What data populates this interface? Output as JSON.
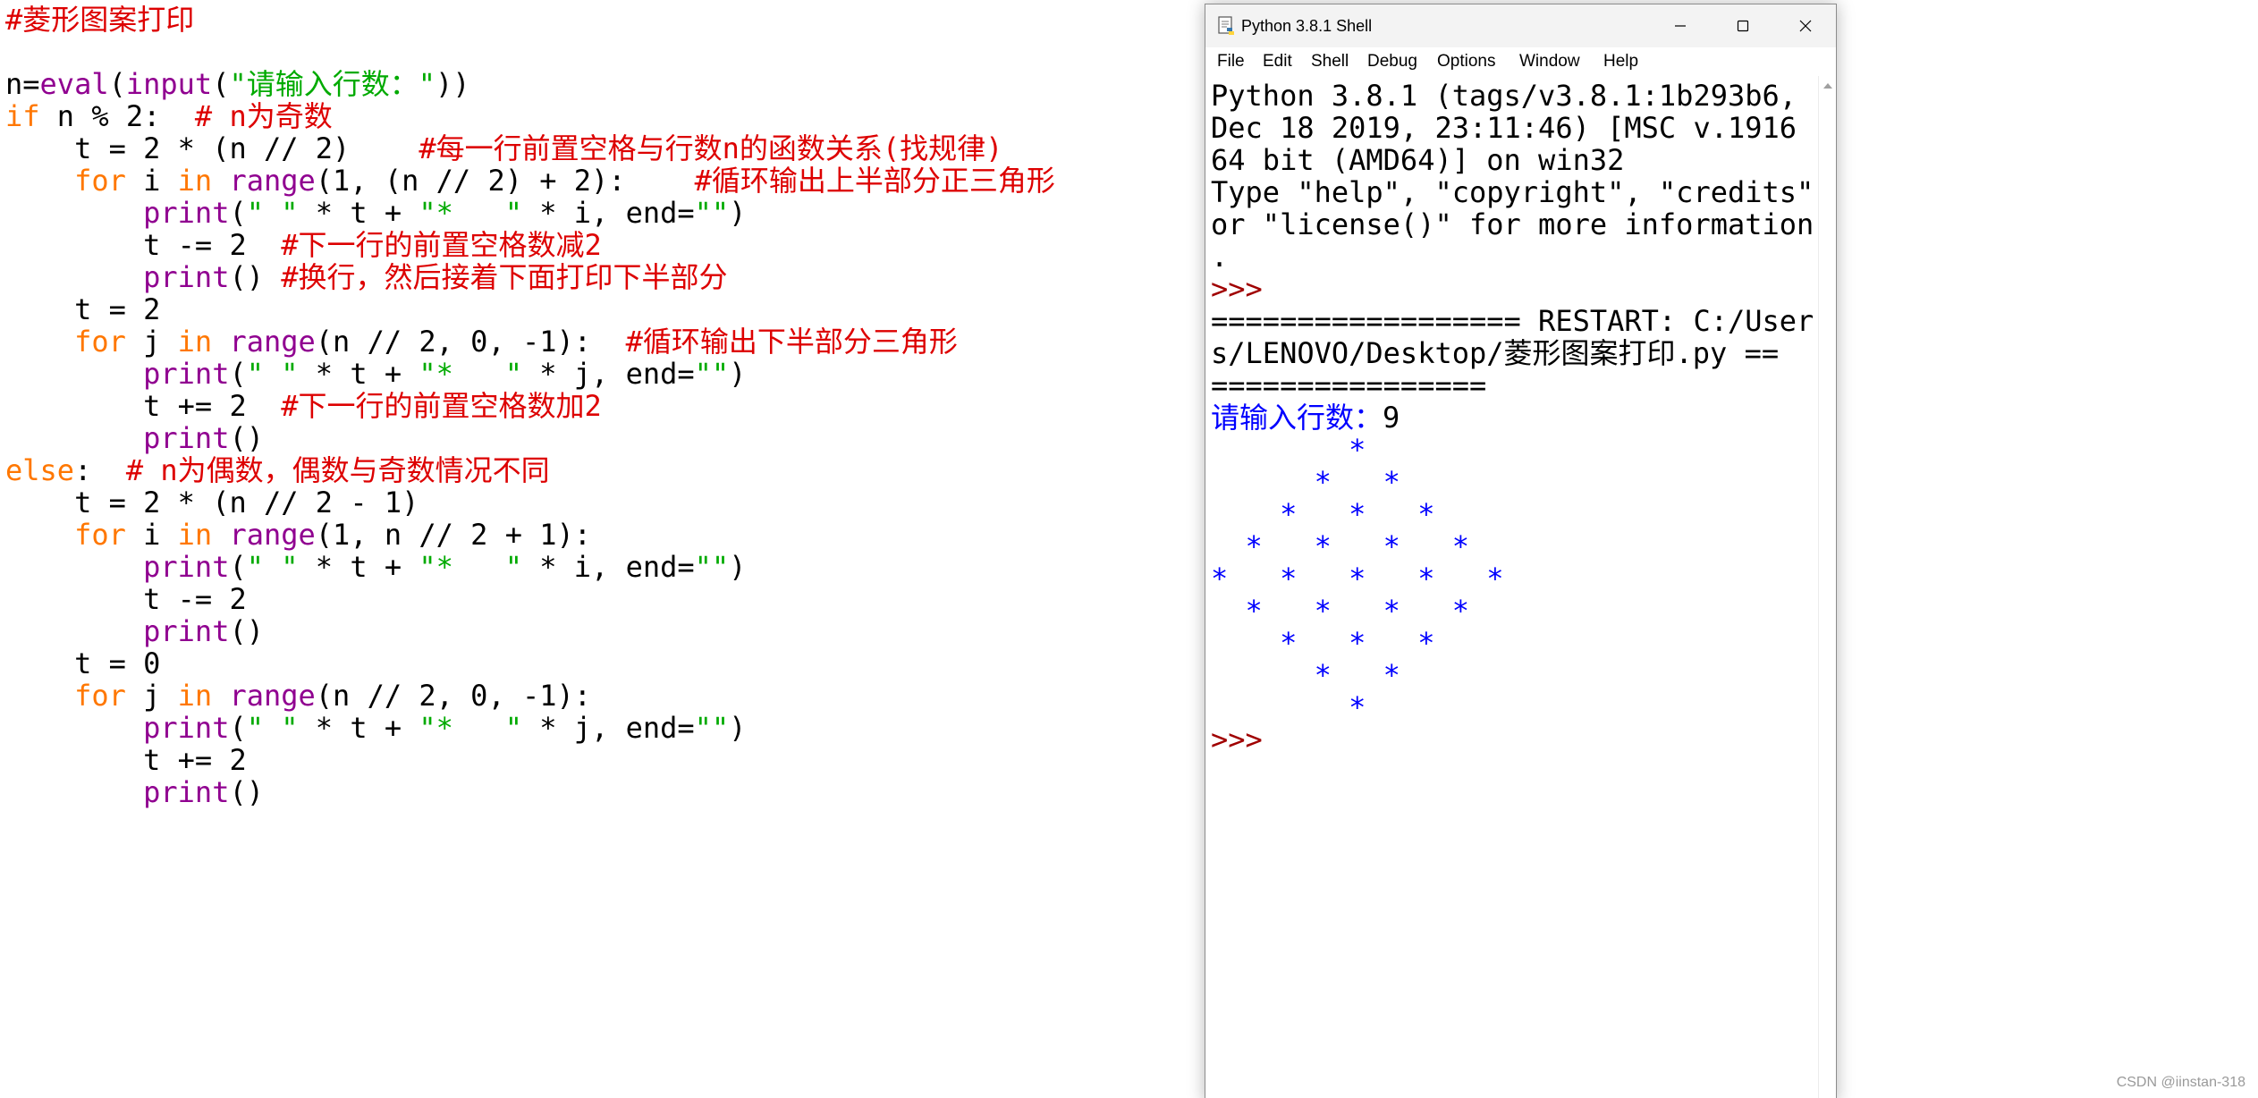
{
  "editor": {
    "lines": [
      [
        [
          "c",
          "#菱形图案打印"
        ]
      ],
      [],
      [
        [
          "d",
          "n="
        ],
        [
          "b",
          "eval"
        ],
        [
          "d",
          "("
        ],
        [
          "b",
          "input"
        ],
        [
          "d",
          "("
        ],
        [
          "s",
          "\"请输入行数：\""
        ],
        [
          "d",
          "))"
        ]
      ],
      [
        [
          "k",
          "if"
        ],
        [
          "d",
          " n % 2:  "
        ],
        [
          "c",
          "# n为奇数"
        ]
      ],
      [
        [
          "d",
          "    t = 2 * (n // 2)    "
        ],
        [
          "c",
          "#每一行前置空格与行数n的函数关系(找规律)"
        ]
      ],
      [
        [
          "d",
          "    "
        ],
        [
          "k",
          "for"
        ],
        [
          "d",
          " i "
        ],
        [
          "k",
          "in"
        ],
        [
          "d",
          " "
        ],
        [
          "b",
          "range"
        ],
        [
          "d",
          "(1, (n // 2) + 2):    "
        ],
        [
          "c",
          "#循环输出上半部分正三角形"
        ]
      ],
      [
        [
          "d",
          "        "
        ],
        [
          "b",
          "print"
        ],
        [
          "d",
          "("
        ],
        [
          "s",
          "\" \""
        ],
        [
          "d",
          " * t + "
        ],
        [
          "s",
          "\"*   \""
        ],
        [
          "d",
          " * i, end="
        ],
        [
          "s",
          "\"\""
        ],
        [
          "d",
          ")"
        ]
      ],
      [
        [
          "d",
          "        t -= 2  "
        ],
        [
          "c",
          "#下一行的前置空格数减2"
        ]
      ],
      [
        [
          "d",
          "        "
        ],
        [
          "b",
          "print"
        ],
        [
          "d",
          "() "
        ],
        [
          "c",
          "#换行，然后接着下面打印下半部分"
        ]
      ],
      [
        [
          "d",
          "    t = 2"
        ]
      ],
      [
        [
          "d",
          "    "
        ],
        [
          "k",
          "for"
        ],
        [
          "d",
          " j "
        ],
        [
          "k",
          "in"
        ],
        [
          "d",
          " "
        ],
        [
          "b",
          "range"
        ],
        [
          "d",
          "(n // 2, 0, -1):  "
        ],
        [
          "c",
          "#循环输出下半部分三角形"
        ]
      ],
      [
        [
          "d",
          "        "
        ],
        [
          "b",
          "print"
        ],
        [
          "d",
          "("
        ],
        [
          "s",
          "\" \""
        ],
        [
          "d",
          " * t + "
        ],
        [
          "s",
          "\"*   \""
        ],
        [
          "d",
          " * j, end="
        ],
        [
          "s",
          "\"\""
        ],
        [
          "d",
          ")"
        ]
      ],
      [
        [
          "d",
          "        t += 2  "
        ],
        [
          "c",
          "#下一行的前置空格数加2"
        ]
      ],
      [
        [
          "d",
          "        "
        ],
        [
          "b",
          "print"
        ],
        [
          "d",
          "()"
        ]
      ],
      [
        [
          "k",
          "else"
        ],
        [
          "d",
          ":  "
        ],
        [
          "c",
          "# n为偶数，偶数与奇数情况不同"
        ]
      ],
      [
        [
          "d",
          "    t = 2 * (n // 2 - 1)"
        ]
      ],
      [
        [
          "d",
          "    "
        ],
        [
          "k",
          "for"
        ],
        [
          "d",
          " i "
        ],
        [
          "k",
          "in"
        ],
        [
          "d",
          " "
        ],
        [
          "b",
          "range"
        ],
        [
          "d",
          "(1, n // 2 + 1):"
        ]
      ],
      [
        [
          "d",
          "        "
        ],
        [
          "b",
          "print"
        ],
        [
          "d",
          "("
        ],
        [
          "s",
          "\" \""
        ],
        [
          "d",
          " * t + "
        ],
        [
          "s",
          "\"*   \""
        ],
        [
          "d",
          " * i, end="
        ],
        [
          "s",
          "\"\""
        ],
        [
          "d",
          ")"
        ]
      ],
      [
        [
          "d",
          "        t -= 2"
        ]
      ],
      [
        [
          "d",
          "        "
        ],
        [
          "b",
          "print"
        ],
        [
          "d",
          "()"
        ]
      ],
      [
        [
          "d",
          "    t = 0"
        ]
      ],
      [
        [
          "d",
          "    "
        ],
        [
          "k",
          "for"
        ],
        [
          "d",
          " j "
        ],
        [
          "k",
          "in"
        ],
        [
          "d",
          " "
        ],
        [
          "b",
          "range"
        ],
        [
          "d",
          "(n // 2, 0, -1):"
        ]
      ],
      [
        [
          "d",
          "        "
        ],
        [
          "b",
          "print"
        ],
        [
          "d",
          "("
        ],
        [
          "s",
          "\" \""
        ],
        [
          "d",
          " * t + "
        ],
        [
          "s",
          "\"*   \""
        ],
        [
          "d",
          " * j, end="
        ],
        [
          "s",
          "\"\""
        ],
        [
          "d",
          ")"
        ]
      ],
      [
        [
          "d",
          "        t += 2"
        ]
      ],
      [
        [
          "d",
          "        "
        ],
        [
          "b",
          "print"
        ],
        [
          "d",
          "()"
        ]
      ]
    ]
  },
  "shell": {
    "title": "Python 3.8.1 Shell",
    "menu": [
      "File",
      "Edit",
      "Shell",
      "Debug",
      "Options",
      "Window",
      "Help"
    ],
    "lines": [
      [
        [
          "out",
          "Python 3.8.1 (tags/v3.8.1:1b293b6,"
        ]
      ],
      [
        [
          "out",
          "Dec 18 2019, 23:11:46) [MSC v.1916"
        ]
      ],
      [
        [
          "out",
          "64 bit (AMD64)] on win32"
        ]
      ],
      [
        [
          "out",
          "Type \"help\", \"copyright\", \"credits\""
        ]
      ],
      [
        [
          "out",
          "or \"license()\" for more information"
        ]
      ],
      [
        [
          "out",
          "."
        ]
      ],
      [
        [
          "prompt",
          ">>> "
        ]
      ],
      [
        [
          "out",
          "================== RESTART: C:/User"
        ]
      ],
      [
        [
          "out",
          "s/LENOVO/Desktop/菱形图案打印.py =="
        ]
      ],
      [
        [
          "out",
          "================"
        ]
      ],
      [
        [
          "stdin",
          "请输入行数："
        ],
        [
          "out",
          "9"
        ]
      ],
      [
        [
          "star",
          "        *   "
        ]
      ],
      [
        [
          "star",
          "      *   *   "
        ]
      ],
      [
        [
          "star",
          "    *   *   *   "
        ]
      ],
      [
        [
          "star",
          "  *   *   *   *   "
        ]
      ],
      [
        [
          "star",
          "*   *   *   *   *   "
        ]
      ],
      [
        [
          "star",
          "  *   *   *   *   "
        ]
      ],
      [
        [
          "star",
          "    *   *   *   "
        ]
      ],
      [
        [
          "star",
          "      *   *   "
        ]
      ],
      [
        [
          "star",
          "        *   "
        ]
      ],
      [
        [
          "prompt",
          ">>> "
        ]
      ]
    ]
  },
  "watermark": "CSDN @iinstan-318"
}
